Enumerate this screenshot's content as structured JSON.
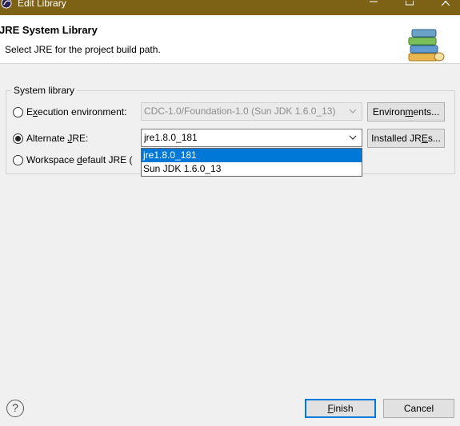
{
  "window": {
    "title": "Edit Library",
    "controls": [
      "minimize-icon",
      "maximize-icon",
      "close-icon"
    ]
  },
  "header": {
    "title": "JRE System Library",
    "description": "Select JRE for the project build path.",
    "image_icon": "library-books-icon"
  },
  "system_library": {
    "legend": "System library",
    "execution_environment": {
      "label_pre": "E",
      "label_mnemonic": "x",
      "label_post": "ecution environment:",
      "value": "CDC-1.0/Foundation-1.0 (Sun JDK 1.6.0_13)",
      "button_pre": "Environ",
      "button_mnemonic": "m",
      "button_post": "ents...",
      "checked": false
    },
    "alternate_jre": {
      "label_pre": "Alternate ",
      "label_mnemonic": "J",
      "label_post": "RE:",
      "value": "jre1.8.0_181",
      "button_pre": "Installed JR",
      "button_mnemonic": "E",
      "button_post": "s...",
      "checked": true,
      "options": [
        "jre1.8.0_181",
        "Sun JDK 1.6.0_13"
      ],
      "selected_index": 0
    },
    "workspace_default": {
      "label_pre": "Workspace ",
      "label_mnemonic": "d",
      "label_post": "efault JRE (",
      "checked": false
    }
  },
  "footer": {
    "help_icon": "help-icon",
    "help_glyph": "?",
    "finish_mnemonic": "F",
    "finish_rest": "inish",
    "cancel": "Cancel"
  },
  "colors": {
    "titlebar": "#7d6215",
    "selection": "#0078d7",
    "background": "#f0f0f0"
  }
}
